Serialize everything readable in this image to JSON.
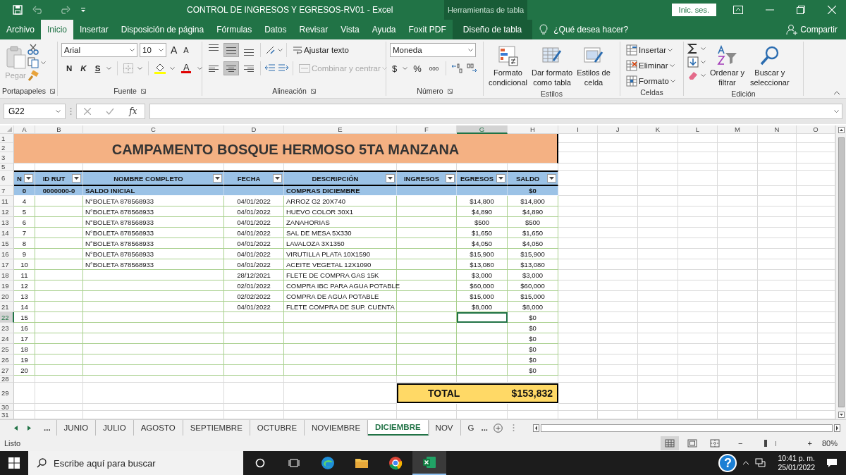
{
  "window": {
    "title": "CONTROL DE INGRESOS Y EGRESOS-RV01  -  Excel",
    "context_label": "Herramientas de tabla",
    "sign_in": "Inic. ses."
  },
  "ribbon_tabs": [
    {
      "label": "Archivo",
      "selected": false,
      "kind": "tab"
    },
    {
      "label": "Inicio",
      "selected": true,
      "kind": "tab"
    },
    {
      "label": "Insertar",
      "selected": false,
      "kind": "tab"
    },
    {
      "label": "Disposición de página",
      "selected": false,
      "kind": "tab"
    },
    {
      "label": "Fórmulas",
      "selected": false,
      "kind": "tab"
    },
    {
      "label": "Datos",
      "selected": false,
      "kind": "tab"
    },
    {
      "label": "Revisar",
      "selected": false,
      "kind": "tab"
    },
    {
      "label": "Vista",
      "selected": false,
      "kind": "tab"
    },
    {
      "label": "Ayuda",
      "selected": false,
      "kind": "tab"
    },
    {
      "label": "Foxit PDF",
      "selected": false,
      "kind": "tab"
    },
    {
      "label": "Diseño de tabla",
      "selected": false,
      "kind": "contextual"
    }
  ],
  "tell_me": "¿Qué desea hacer?",
  "share": "Compartir",
  "ribbon": {
    "clipboard": {
      "label": "Portapapeles",
      "paste": "Pegar"
    },
    "font": {
      "label": "Fuente",
      "font_name": "Arial",
      "font_size": "10",
      "grow": "A",
      "shrink": "A",
      "bold": "N",
      "italic": "K",
      "underline": "S",
      "font_color": "A"
    },
    "alignment": {
      "label": "Alineación",
      "vertical": [
        {
          "selected": false
        },
        {
          "selected": true
        },
        {
          "selected": false
        }
      ],
      "horizontal": [
        {
          "selected": false
        },
        {
          "selected": true
        },
        {
          "selected": false
        }
      ],
      "wrap": "Ajustar texto",
      "merge": "Combinar y centrar",
      "merge_disabled": true
    },
    "number": {
      "label": "Número",
      "format": "Moneda",
      "currency": "$",
      "percent": "%",
      "thousands": "000"
    },
    "styles": {
      "label": "Estilos",
      "buttons": [
        {
          "lines": [
            "Formato",
            "condicional"
          ],
          "kind": "conditional"
        },
        {
          "lines": [
            "Dar formato",
            "como tabla"
          ],
          "kind": "table"
        },
        {
          "lines": [
            "Estilos de",
            "celda"
          ],
          "kind": "cell"
        }
      ]
    },
    "cells": {
      "label": "Celdas",
      "buttons": [
        {
          "label": "Insertar",
          "kind": "insert"
        },
        {
          "label": "Eliminar",
          "kind": "delete"
        },
        {
          "label": "Formato",
          "kind": "format"
        }
      ]
    },
    "editing": {
      "label": "Edición",
      "buttons": [
        {
          "lines": [
            "Ordenar y",
            "filtrar"
          ],
          "kind": "sort"
        },
        {
          "lines": [
            "Buscar y",
            "seleccionar"
          ],
          "kind": "find"
        }
      ]
    }
  },
  "formula_bar": {
    "name_box": "G22",
    "fx": "fx"
  },
  "sheet": {
    "columns": [
      {
        "label": "A",
        "selected": false
      },
      {
        "label": "B",
        "selected": false
      },
      {
        "label": "C",
        "selected": false
      },
      {
        "label": "D",
        "selected": false
      },
      {
        "label": "E",
        "selected": false
      },
      {
        "label": "F",
        "selected": false
      },
      {
        "label": "G",
        "selected": true
      },
      {
        "label": "H",
        "selected": false
      },
      {
        "label": "I",
        "selected": false
      },
      {
        "label": "J",
        "selected": false
      },
      {
        "label": "K",
        "selected": false
      },
      {
        "label": "L",
        "selected": false
      },
      {
        "label": "M",
        "selected": false
      },
      {
        "label": "N",
        "selected": false
      },
      {
        "label": "O",
        "selected": false
      }
    ],
    "rows": [
      {
        "kind": "title",
        "numbers": [
          "1",
          "2",
          "3"
        ],
        "title": "CAMPAMENTO BOSQUE HERMOSO 5TA MANZANA",
        "selected": false
      },
      {
        "kind": "blank",
        "number": "5",
        "selected": false
      },
      {
        "kind": "header",
        "number": "6",
        "headers": [
          "N",
          "ID RUT",
          "NOMBRE COMPLETO",
          "FECHA",
          "DESCRIPCIÓN",
          "INGRESOS",
          "EGRESOS",
          "SALDO"
        ],
        "selected": false
      },
      {
        "kind": "saldo",
        "number": "7",
        "selected": false,
        "cells": {
          "a": "0",
          "b": "0000000-0",
          "c": "SALDO INICIAL",
          "e": "COMPRAS DICIEMBRE",
          "h": "$0"
        }
      },
      {
        "kind": "data",
        "number": "11",
        "selected": false,
        "cells": {
          "a": "4",
          "c": "N°BOLETA 878568933",
          "d": "04/01/2022",
          "e": "ARROZ G2 20X740",
          "g": "$14,800",
          "h": "$14,800"
        }
      },
      {
        "kind": "data",
        "number": "12",
        "selected": false,
        "cells": {
          "a": "5",
          "c": "N°BOLETA 878568933",
          "d": "04/01/2022",
          "e": "HUEVO COLOR 30X1",
          "g": "$4,890",
          "h": "$4,890"
        }
      },
      {
        "kind": "data",
        "number": "13",
        "selected": false,
        "cells": {
          "a": "6",
          "c": "N°BOLETA 878568933",
          "d": "04/01/2022",
          "e": "ZANAHORIAS",
          "g": "$500",
          "h": "$500"
        }
      },
      {
        "kind": "data",
        "number": "14",
        "selected": false,
        "cells": {
          "a": "7",
          "c": "N°BOLETA 878568933",
          "d": "04/01/2022",
          "e": "SAL DE MESA 5X330",
          "g": "$1,650",
          "h": "$1,650"
        }
      },
      {
        "kind": "data",
        "number": "15",
        "selected": false,
        "cells": {
          "a": "8",
          "c": "N°BOLETA 878568933",
          "d": "04/01/2022",
          "e": "LAVALOZA 3X1350",
          "g": "$4,050",
          "h": "$4,050"
        }
      },
      {
        "kind": "data",
        "number": "16",
        "selected": false,
        "cells": {
          "a": "9",
          "c": "N°BOLETA 878568933",
          "d": "04/01/2022",
          "e": "VIRUTILLA PLATA 10X1590",
          "g": "$15,900",
          "h": "$15,900"
        }
      },
      {
        "kind": "data",
        "number": "17",
        "selected": false,
        "cells": {
          "a": "10",
          "c": "N°BOLETA 878568933",
          "d": "04/01/2022",
          "e": "ACEITE VEGETAL 12X1090",
          "g": "$13,080",
          "h": "$13,080"
        }
      },
      {
        "kind": "data",
        "number": "18",
        "selected": false,
        "cells": {
          "a": "11",
          "d": "28/12/2021",
          "e": "FLETE DE COMPRA GAS 15K",
          "g": "$3,000",
          "h": "$3,000"
        }
      },
      {
        "kind": "data",
        "number": "19",
        "selected": false,
        "cells": {
          "a": "12",
          "d": "02/01/2022",
          "e": "COMPRA IBC PARA AGUA POTABLE",
          "g": "$60,000",
          "h": "$60,000"
        }
      },
      {
        "kind": "data",
        "number": "20",
        "selected": false,
        "cells": {
          "a": "13",
          "d": "02/02/2022",
          "e": "COMPRA DE AGUA POTABLE",
          "g": "$15,000",
          "h": "$15,000"
        }
      },
      {
        "kind": "data",
        "number": "21",
        "selected": false,
        "cells": {
          "a": "14",
          "d": "04/01/2022",
          "e": "FLETE COMPRA DE SUP. CUENTA",
          "g": "$8,000",
          "h": "$8,000"
        }
      },
      {
        "kind": "data",
        "number": "22",
        "selected": true,
        "cells": {
          "a": "15",
          "h": "$0"
        }
      },
      {
        "kind": "data",
        "number": "23",
        "selected": false,
        "cells": {
          "a": "16",
          "h": "$0"
        }
      },
      {
        "kind": "data",
        "number": "24",
        "selected": false,
        "cells": {
          "a": "17",
          "h": "$0"
        }
      },
      {
        "kind": "data",
        "number": "25",
        "selected": false,
        "cells": {
          "a": "18",
          "h": "$0"
        }
      },
      {
        "kind": "data",
        "number": "26",
        "selected": false,
        "cells": {
          "a": "19",
          "h": "$0"
        }
      },
      {
        "kind": "data",
        "number": "27",
        "selected": false,
        "cells": {
          "a": "20",
          "h": "$0"
        }
      },
      {
        "kind": "blank",
        "number": "28",
        "selected": false
      },
      {
        "kind": "total",
        "number": "29",
        "label": "TOTAL",
        "value": "$153,832",
        "selected": false
      },
      {
        "kind": "blank",
        "number": "30",
        "selected": false
      },
      {
        "kind": "blank",
        "number": "31",
        "selected": false
      }
    ]
  },
  "sheet_tabs": {
    "leading_more": "...",
    "tabs": [
      {
        "label": "JUNIO",
        "selected": false
      },
      {
        "label": "JULIO",
        "selected": false
      },
      {
        "label": "AGOSTO",
        "selected": false
      },
      {
        "label": "SEPTIEMBRE",
        "selected": false
      },
      {
        "label": "OCTUBRE",
        "selected": false
      },
      {
        "label": "NOVIEMBRE",
        "selected": false
      },
      {
        "label": "DICIEMBRE",
        "selected": true
      },
      {
        "label": "NOV",
        "selected": false
      },
      {
        "label": "G",
        "selected": false
      }
    ],
    "trailing_more": "..."
  },
  "status_bar": {
    "status": "Listo",
    "views": [
      {
        "kind": "normal",
        "selected": true
      },
      {
        "kind": "layout",
        "selected": false
      },
      {
        "kind": "breaks",
        "selected": false
      }
    ],
    "zoom": {
      "minus": "−",
      "plus": "+",
      "level": 0.33,
      "reading": "80%"
    }
  },
  "taskbar": {
    "search_placeholder": "Escribe aquí para buscar",
    "apps": [
      {
        "kind": "cortana",
        "selected": false
      },
      {
        "kind": "taskview",
        "selected": false
      },
      {
        "kind": "edge",
        "selected": false
      },
      {
        "kind": "folder",
        "selected": false
      },
      {
        "kind": "chrome",
        "selected": false
      },
      {
        "kind": "excel",
        "selected": true
      }
    ],
    "help": "?",
    "time": "10:41 p. m.",
    "date": "25/01/2022"
  }
}
